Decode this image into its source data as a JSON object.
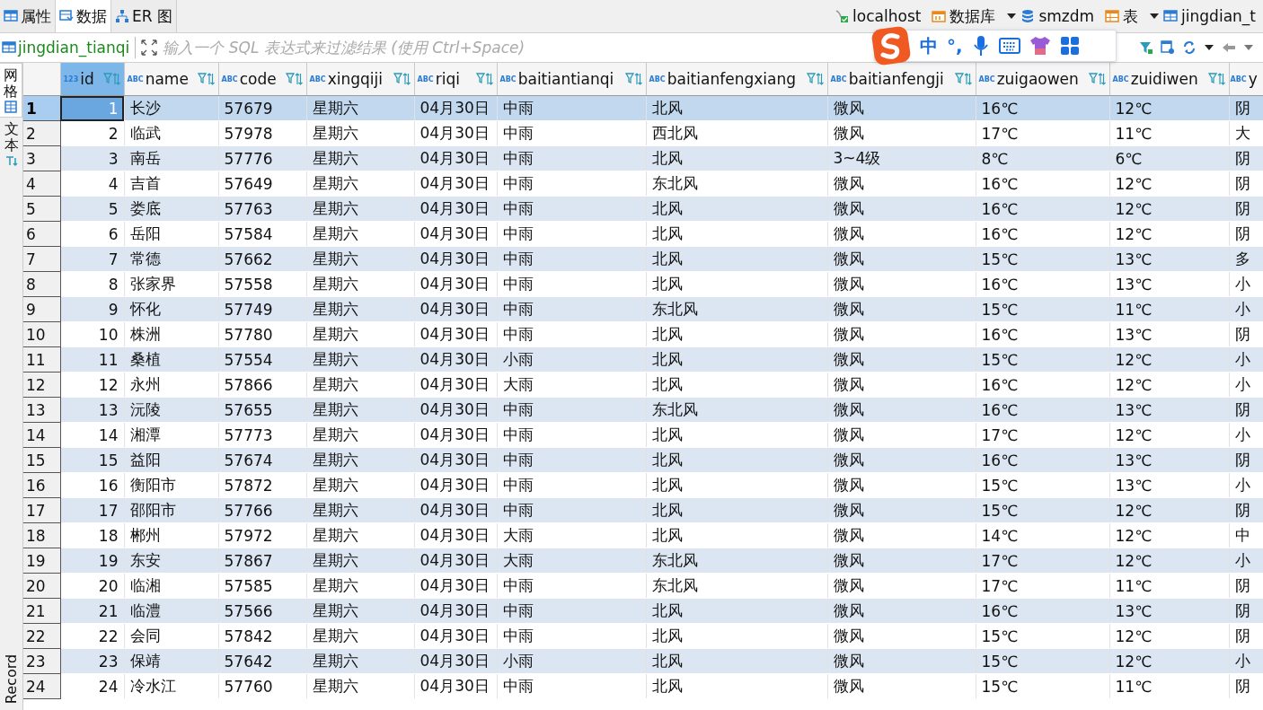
{
  "editor_tabs": [
    {
      "label": "属性",
      "selected": false
    },
    {
      "label": "数据",
      "selected": true
    },
    {
      "label": "ER 图",
      "selected": false
    }
  ],
  "breadcrumb": [
    {
      "label": "localhost",
      "dropdown": false
    },
    {
      "label": "数据库",
      "dropdown": true
    },
    {
      "label": "smzdm",
      "dropdown": false
    },
    {
      "label": "表",
      "dropdown": true
    },
    {
      "label": "jingdian_t",
      "dropdown": false
    }
  ],
  "filter_bar": {
    "table_name": "jingdian_tianqi",
    "placeholder": "输入一个 SQL 表达式来过滤结果 (使用 Ctrl+Space)"
  },
  "ime_toolbar": {
    "mode": "中",
    "punctuation": "°,"
  },
  "side_tabs": [
    {
      "label": "网格",
      "kind": "cjk",
      "selected": true
    },
    {
      "label": "文本",
      "kind": "cjk",
      "selected": false
    },
    {
      "label": "Record",
      "kind": "latin",
      "selected": false
    }
  ],
  "table": {
    "columns": [
      {
        "label": "id",
        "type_label": "123"
      },
      {
        "label": "name",
        "type_label": "ABC"
      },
      {
        "label": "code",
        "type_label": "ABC"
      },
      {
        "label": "xingqiji",
        "type_label": "ABC"
      },
      {
        "label": "riqi",
        "type_label": "ABC"
      },
      {
        "label": "baitiantianqi",
        "type_label": "ABC"
      },
      {
        "label": "baitianfengxiang",
        "type_label": "ABC"
      },
      {
        "label": "baitianfengji",
        "type_label": "ABC"
      },
      {
        "label": "zuigaowen",
        "type_label": "ABC"
      },
      {
        "label": "zuidiwen",
        "type_label": "ABC"
      },
      {
        "label": "y",
        "type_label": "ABC"
      }
    ],
    "rows": [
      {
        "number": "1",
        "selected": true,
        "cells": [
          "1",
          "长沙",
          "57679",
          "星期六",
          "04月30日",
          "中雨",
          "北风",
          "微风",
          "16℃",
          "12℃",
          "阴"
        ]
      },
      {
        "number": "2",
        "selected": false,
        "cells": [
          "2",
          "临武",
          "57978",
          "星期六",
          "04月30日",
          "中雨",
          "西北风",
          "微风",
          "17℃",
          "11℃",
          "大"
        ]
      },
      {
        "number": "3",
        "selected": false,
        "cells": [
          "3",
          "南岳",
          "57776",
          "星期六",
          "04月30日",
          "中雨",
          "北风",
          "3~4级",
          "8℃",
          "6℃",
          "阴"
        ]
      },
      {
        "number": "4",
        "selected": false,
        "cells": [
          "4",
          "吉首",
          "57649",
          "星期六",
          "04月30日",
          "中雨",
          "东北风",
          "微风",
          "16℃",
          "12℃",
          "阴"
        ]
      },
      {
        "number": "5",
        "selected": false,
        "cells": [
          "5",
          "娄底",
          "57763",
          "星期六",
          "04月30日",
          "中雨",
          "北风",
          "微风",
          "16℃",
          "12℃",
          "阴"
        ]
      },
      {
        "number": "6",
        "selected": false,
        "cells": [
          "6",
          "岳阳",
          "57584",
          "星期六",
          "04月30日",
          "中雨",
          "北风",
          "微风",
          "16℃",
          "12℃",
          "阴"
        ]
      },
      {
        "number": "7",
        "selected": false,
        "cells": [
          "7",
          "常德",
          "57662",
          "星期六",
          "04月30日",
          "中雨",
          "北风",
          "微风",
          "15℃",
          "13℃",
          "多"
        ]
      },
      {
        "number": "8",
        "selected": false,
        "cells": [
          "8",
          "张家界",
          "57558",
          "星期六",
          "04月30日",
          "中雨",
          "北风",
          "微风",
          "16℃",
          "13℃",
          "小"
        ]
      },
      {
        "number": "9",
        "selected": false,
        "cells": [
          "9",
          "怀化",
          "57749",
          "星期六",
          "04月30日",
          "中雨",
          "东北风",
          "微风",
          "15℃",
          "11℃",
          "小"
        ]
      },
      {
        "number": "10",
        "selected": false,
        "cells": [
          "10",
          "株洲",
          "57780",
          "星期六",
          "04月30日",
          "中雨",
          "北风",
          "微风",
          "16℃",
          "13℃",
          "阴"
        ]
      },
      {
        "number": "11",
        "selected": false,
        "cells": [
          "11",
          "桑植",
          "57554",
          "星期六",
          "04月30日",
          "小雨",
          "北风",
          "微风",
          "15℃",
          "12℃",
          "小"
        ]
      },
      {
        "number": "12",
        "selected": false,
        "cells": [
          "12",
          "永州",
          "57866",
          "星期六",
          "04月30日",
          "大雨",
          "北风",
          "微风",
          "16℃",
          "12℃",
          "小"
        ]
      },
      {
        "number": "13",
        "selected": false,
        "cells": [
          "13",
          "沅陵",
          "57655",
          "星期六",
          "04月30日",
          "中雨",
          "东北风",
          "微风",
          "16℃",
          "13℃",
          "阴"
        ]
      },
      {
        "number": "14",
        "selected": false,
        "cells": [
          "14",
          "湘潭",
          "57773",
          "星期六",
          "04月30日",
          "中雨",
          "北风",
          "微风",
          "17℃",
          "12℃",
          "小"
        ]
      },
      {
        "number": "15",
        "selected": false,
        "cells": [
          "15",
          "益阳",
          "57674",
          "星期六",
          "04月30日",
          "中雨",
          "北风",
          "微风",
          "16℃",
          "13℃",
          "阴"
        ]
      },
      {
        "number": "16",
        "selected": false,
        "cells": [
          "16",
          "衡阳市",
          "57872",
          "星期六",
          "04月30日",
          "中雨",
          "北风",
          "微风",
          "15℃",
          "13℃",
          "小"
        ]
      },
      {
        "number": "17",
        "selected": false,
        "cells": [
          "17",
          "邵阳市",
          "57766",
          "星期六",
          "04月30日",
          "中雨",
          "北风",
          "微风",
          "15℃",
          "12℃",
          "阴"
        ]
      },
      {
        "number": "18",
        "selected": false,
        "cells": [
          "18",
          "郴州",
          "57972",
          "星期六",
          "04月30日",
          "大雨",
          "北风",
          "微风",
          "14℃",
          "12℃",
          "中"
        ]
      },
      {
        "number": "19",
        "selected": false,
        "cells": [
          "19",
          "东安",
          "57867",
          "星期六",
          "04月30日",
          "大雨",
          "东北风",
          "微风",
          "17℃",
          "12℃",
          "小"
        ]
      },
      {
        "number": "20",
        "selected": false,
        "cells": [
          "20",
          "临湘",
          "57585",
          "星期六",
          "04月30日",
          "中雨",
          "东北风",
          "微风",
          "17℃",
          "11℃",
          "阴"
        ]
      },
      {
        "number": "21",
        "selected": false,
        "cells": [
          "21",
          "临澧",
          "57566",
          "星期六",
          "04月30日",
          "中雨",
          "北风",
          "微风",
          "16℃",
          "13℃",
          "阴"
        ]
      },
      {
        "number": "22",
        "selected": false,
        "cells": [
          "22",
          "会同",
          "57842",
          "星期六",
          "04月30日",
          "中雨",
          "北风",
          "微风",
          "15℃",
          "12℃",
          "阴"
        ]
      },
      {
        "number": "23",
        "selected": false,
        "cells": [
          "23",
          "保靖",
          "57642",
          "星期六",
          "04月30日",
          "小雨",
          "北风",
          "微风",
          "15℃",
          "12℃",
          "小"
        ]
      },
      {
        "number": "24",
        "selected": false,
        "cells": [
          "24",
          "冷水江",
          "57760",
          "星期六",
          "04月30日",
          "中雨",
          "北风",
          "微风",
          "15℃",
          "11℃",
          "阴"
        ]
      }
    ]
  }
}
